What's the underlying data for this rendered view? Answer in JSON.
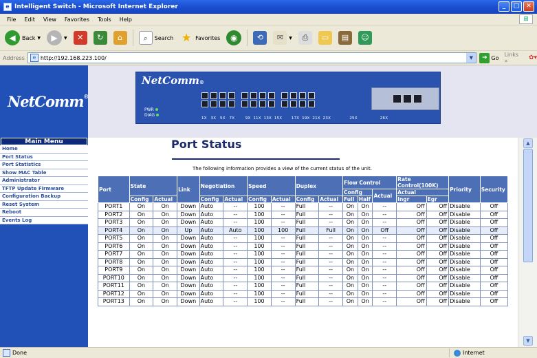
{
  "window": {
    "title": "Intelligent Switch - Microsoft Internet Explorer"
  },
  "menubar": [
    "File",
    "Edit",
    "View",
    "Favorites",
    "Tools",
    "Help"
  ],
  "toolbar": {
    "back": "Back",
    "search": "Search",
    "favorites": "Favorites"
  },
  "address": {
    "label": "Address",
    "url": "http://192.168.223.100/",
    "go": "Go",
    "links": "Links"
  },
  "brand": {
    "logo": "NetComm"
  },
  "device": {
    "logo": "NetComm",
    "pwr": "PWR",
    "diag": "DIAG",
    "port_labels": "1X   3X   5X   7X        9X  11X  13X  15X       17X  19X  21X  23X              25X                 26X"
  },
  "sidebar": {
    "header": "Main Menu",
    "items": [
      "Home",
      "Port Status",
      "Port Statistics",
      "Show MAC Table",
      "Administrator",
      "TFTP Update Firmware",
      "Configuration Backup",
      "Reset System",
      "Reboot",
      "Events Log"
    ]
  },
  "main": {
    "title": "Port Status",
    "intro": "The following information provides a view of the current status of the unit."
  },
  "table": {
    "h": {
      "port": "Port",
      "state": "State",
      "link": "Link",
      "negotiation": "Negotiation",
      "speed": "Speed",
      "duplex": "Duplex",
      "flow_control": "Flow Control",
      "rate_control": "Rate Control(100K)",
      "priority": "Priority",
      "security": "Security",
      "config": "Config",
      "actual": "Actual",
      "full": "Full",
      "half": "Half",
      "ingr": "Ingr",
      "egr": "Egr"
    },
    "rows": [
      [
        "PORT1",
        "On",
        "On",
        "Down",
        "Auto",
        "--",
        "100",
        "--",
        "Full",
        "--",
        "On",
        "On",
        "--",
        "Off",
        "Off",
        "Disable",
        "Off"
      ],
      [
        "PORT2",
        "On",
        "On",
        "Down",
        "Auto",
        "--",
        "100",
        "--",
        "Full",
        "--",
        "On",
        "On",
        "--",
        "Off",
        "Off",
        "Disable",
        "Off"
      ],
      [
        "PORT3",
        "On",
        "On",
        "Down",
        "Auto",
        "--",
        "100",
        "--",
        "Full",
        "--",
        "On",
        "On",
        "--",
        "Off",
        "Off",
        "Disable",
        "Off"
      ],
      [
        "PORT4",
        "On",
        "On",
        "Up",
        "Auto",
        "Auto",
        "100",
        "100",
        "Full",
        "Full",
        "On",
        "On",
        "Off",
        "Off",
        "Off",
        "Disable",
        "Off"
      ],
      [
        "PORT5",
        "On",
        "On",
        "Down",
        "Auto",
        "--",
        "100",
        "--",
        "Full",
        "--",
        "On",
        "On",
        "--",
        "Off",
        "Off",
        "Disable",
        "Off"
      ],
      [
        "PORT6",
        "On",
        "On",
        "Down",
        "Auto",
        "--",
        "100",
        "--",
        "Full",
        "--",
        "On",
        "On",
        "--",
        "Off",
        "Off",
        "Disable",
        "Off"
      ],
      [
        "PORT7",
        "On",
        "On",
        "Down",
        "Auto",
        "--",
        "100",
        "--",
        "Full",
        "--",
        "On",
        "On",
        "--",
        "Off",
        "Off",
        "Disable",
        "Off"
      ],
      [
        "PORT8",
        "On",
        "On",
        "Down",
        "Auto",
        "--",
        "100",
        "--",
        "Full",
        "--",
        "On",
        "On",
        "--",
        "Off",
        "Off",
        "Disable",
        "Off"
      ],
      [
        "PORT9",
        "On",
        "On",
        "Down",
        "Auto",
        "--",
        "100",
        "--",
        "Full",
        "--",
        "On",
        "On",
        "--",
        "Off",
        "Off",
        "Disable",
        "Off"
      ],
      [
        "PORT10",
        "On",
        "On",
        "Down",
        "Auto",
        "--",
        "100",
        "--",
        "Full",
        "--",
        "On",
        "On",
        "--",
        "Off",
        "Off",
        "Disable",
        "Off"
      ],
      [
        "PORT11",
        "On",
        "On",
        "Down",
        "Auto",
        "--",
        "100",
        "--",
        "Full",
        "--",
        "On",
        "On",
        "--",
        "Off",
        "Off",
        "Disable",
        "Off"
      ],
      [
        "PORT12",
        "On",
        "On",
        "Down",
        "Auto",
        "--",
        "100",
        "--",
        "Full",
        "--",
        "On",
        "On",
        "--",
        "Off",
        "Off",
        "Disable",
        "Off"
      ],
      [
        "PORT13",
        "On",
        "On",
        "Down",
        "Auto",
        "--",
        "100",
        "--",
        "Full",
        "--",
        "On",
        "On",
        "--",
        "Off",
        "Off",
        "Disable",
        "Off"
      ]
    ]
  },
  "status": {
    "left": "Done",
    "zone": "Internet"
  },
  "colors": {
    "brand_blue": "#2151b7",
    "header_blue": "#4c6fb5",
    "title_blue": "#1a4fd0"
  }
}
